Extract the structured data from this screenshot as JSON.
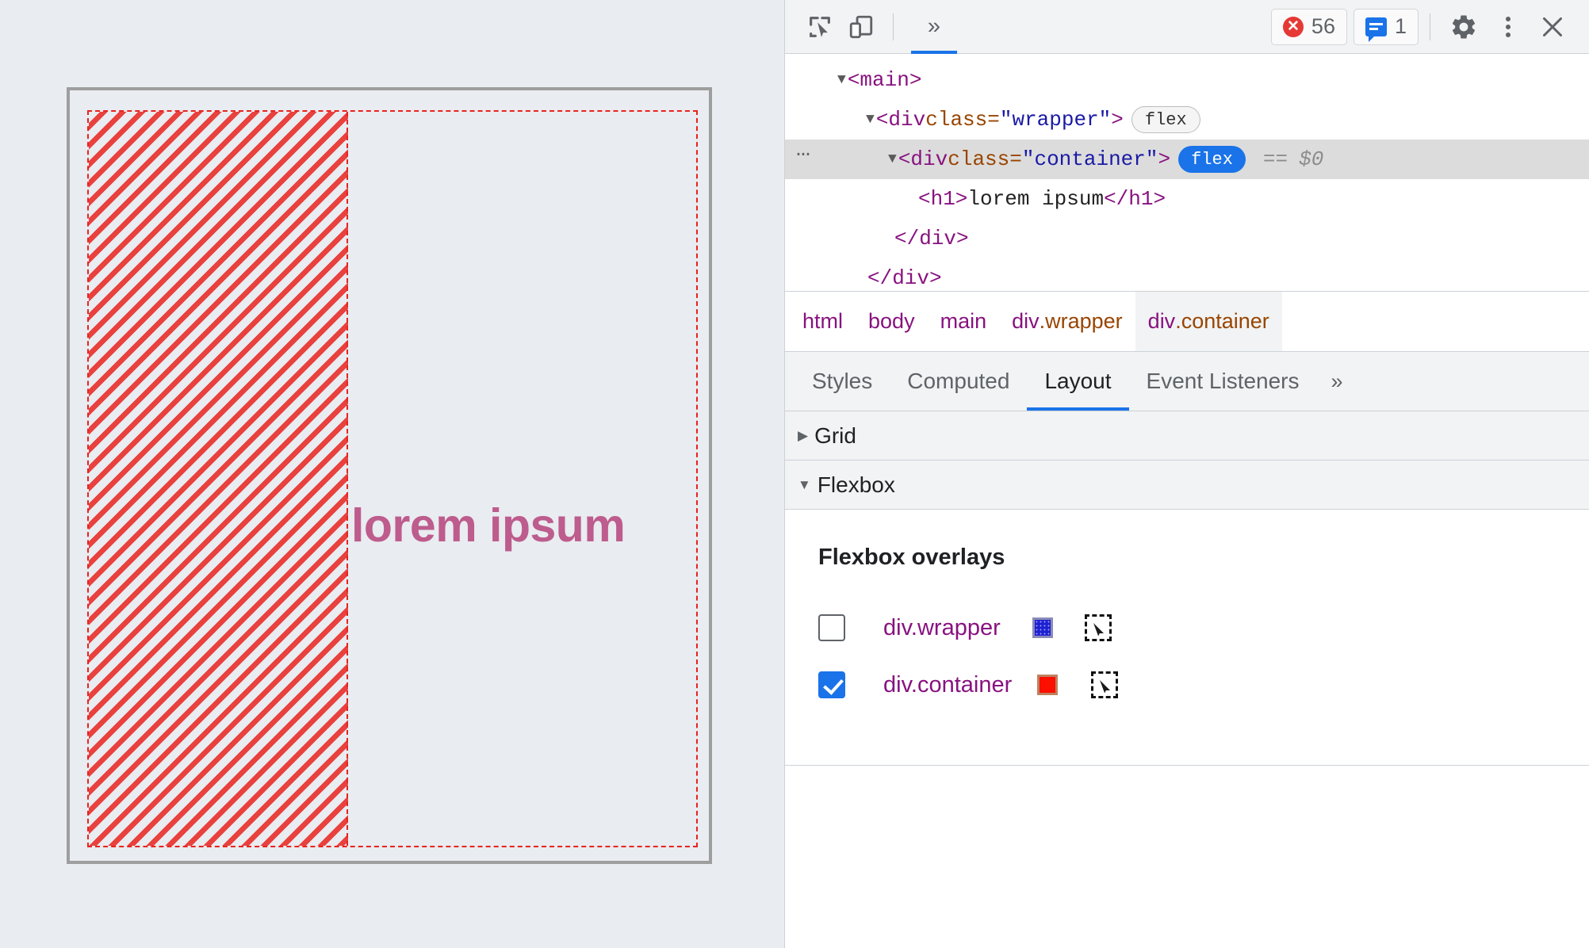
{
  "page": {
    "heading": "lorem ipsum"
  },
  "toolbar": {
    "inspect_icon": "inspect-element-icon",
    "device_icon": "device-toolbar-icon",
    "more_panels_icon": "»",
    "errors_label": "56",
    "warnings_label": "1",
    "settings_icon": "gear-icon",
    "more_icon": "kebab-menu-icon",
    "close_icon": "close-icon"
  },
  "dom_tree": {
    "rows": [
      {
        "twisty": "▼",
        "open_tag": "<main>",
        "chip": null
      },
      {
        "twisty": "▼",
        "tag_open": "<div ",
        "attr_name": "class=",
        "attr_value": "\"wrapper\"",
        "tag_close": ">",
        "chip": "flex"
      },
      {
        "dots": "…",
        "twisty": "▼",
        "tag_open": "<div ",
        "attr_name": "class=",
        "attr_value": "\"container\"",
        "tag_close": ">",
        "chip": "flex",
        "equals": "==",
        "dollar": "$0"
      },
      {
        "h1_open": "<h1>",
        "h1_text": "lorem ipsum",
        "h1_close": "</h1>"
      },
      {
        "close_inner": "</div>"
      },
      {
        "close_outer": "</div>"
      }
    ]
  },
  "breadcrumb": {
    "items": [
      {
        "label": "html",
        "cls": "",
        "active": false
      },
      {
        "label": "body",
        "cls": "",
        "active": false
      },
      {
        "label": "main",
        "cls": "",
        "active": false
      },
      {
        "label": "div",
        "cls": ".wrapper",
        "active": false
      },
      {
        "label": "div",
        "cls": ".container",
        "active": true
      }
    ]
  },
  "tabs": {
    "items": [
      {
        "label": "Styles",
        "active": false
      },
      {
        "label": "Computed",
        "active": false
      },
      {
        "label": "Layout",
        "active": true
      },
      {
        "label": "Event Listeners",
        "active": false
      }
    ],
    "more": "»"
  },
  "sections": {
    "grid": {
      "label": "Grid",
      "arrow": "▶",
      "expanded": false
    },
    "flexbox": {
      "label": "Flexbox",
      "arrow": "▼",
      "expanded": true
    }
  },
  "flexbox_overlays": {
    "title": "Flexbox overlays",
    "rows": [
      {
        "name": "div.wrapper",
        "checked": false,
        "color": "#2020d0",
        "picker_icon": "select-element-icon"
      },
      {
        "name": "div.container",
        "checked": true,
        "color": "#fa0f00",
        "picker_icon": "select-element-icon"
      }
    ]
  },
  "colors": {
    "accent": "#1a73e8",
    "overlay_red": "#e8231f",
    "heading": "#bd5c8d",
    "tag": "#881280",
    "attr_name": "#994500",
    "attr_value": "#1a1aa6",
    "page_bg": "#e9ecf0",
    "toolbar_bg": "#f1f3f4"
  }
}
